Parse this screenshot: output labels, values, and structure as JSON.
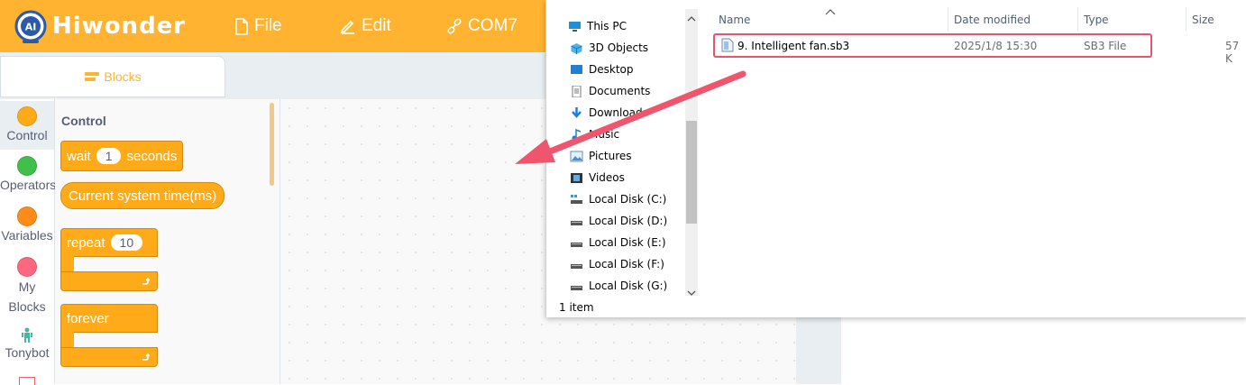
{
  "colors": {
    "accent": "#ffb331",
    "arrow": "#f0556e",
    "highlight": "#e8536e"
  },
  "header": {
    "brand": "Hiwonder",
    "logo_text": "AI",
    "menu": [
      {
        "label": "File",
        "icon": "file-icon"
      },
      {
        "label": "Edit",
        "icon": "pencil-icon"
      },
      {
        "label": "COM7",
        "icon": "link-icon"
      }
    ]
  },
  "tabs": {
    "blocks_label": "Blocks"
  },
  "categories": [
    {
      "label": "Control",
      "color": "#ffab19"
    },
    {
      "label": "Operators",
      "color": "#40bf4a"
    },
    {
      "label": "Variables",
      "color": "#ff8c1a"
    },
    {
      "label": "My Blocks",
      "color": "#ff6680"
    },
    {
      "label": "Tonybot",
      "icon": "robot-icon"
    }
  ],
  "palette": {
    "title": "Control",
    "wait": {
      "prefix": "wait",
      "value": "1",
      "suffix": "seconds"
    },
    "system_time": "Current system time(ms)",
    "repeat": {
      "label": "repeat",
      "value": "10"
    },
    "forever": "forever"
  },
  "explorer": {
    "nav": [
      {
        "label": "This PC",
        "icon": "pc-icon"
      },
      {
        "label": "3D Objects",
        "icon": "cube-icon"
      },
      {
        "label": "Desktop",
        "icon": "desktop-icon"
      },
      {
        "label": "Documents",
        "icon": "document-icon"
      },
      {
        "label": "Downloads",
        "icon": "download-icon"
      },
      {
        "label": "Music",
        "icon": "music-icon"
      },
      {
        "label": "Pictures",
        "icon": "pictures-icon"
      },
      {
        "label": "Videos",
        "icon": "videos-icon"
      },
      {
        "label": "Local Disk (C:)",
        "icon": "drive-icon"
      },
      {
        "label": "Local Disk (D:)",
        "icon": "drive-icon"
      },
      {
        "label": "Local Disk (E:)",
        "icon": "drive-icon"
      },
      {
        "label": "Local Disk (F:)",
        "icon": "drive-icon"
      },
      {
        "label": "Local Disk (G:)",
        "icon": "drive-icon"
      }
    ],
    "columns": [
      "Name",
      "Date modified",
      "Type",
      "Size"
    ],
    "file": {
      "name": "9. Intelligent fan.sb3",
      "date": "2025/1/8 15:30",
      "type": "SB3 File",
      "size": "57 K"
    },
    "status": "1 item"
  }
}
